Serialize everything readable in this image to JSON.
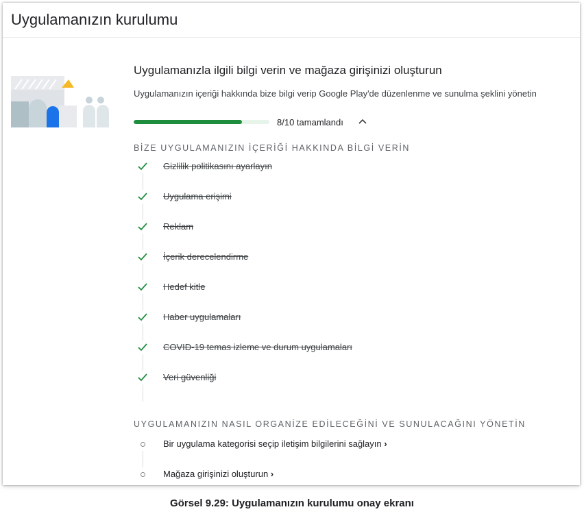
{
  "page": {
    "title": "Uygulamanızın kurulumu"
  },
  "section": {
    "heading": "Uygulamanızla ilgili bilgi verin ve mağaza girişinizi oluşturun",
    "description": "Uygulamanızın içeriği hakkında bize bilgi verip Google Play'de düzenlenme ve sunulma şeklini yönetin",
    "progress": {
      "completed": 8,
      "total": 10,
      "label": "8/10 tamamlandı"
    }
  },
  "groups": [
    {
      "title": "BİZE UYGULAMANIZIN İÇERİĞİ HAKKINDA BİLGİ VERİN",
      "tasks": [
        {
          "label": "Gizlilik politikasını ayarlayın",
          "status": "done"
        },
        {
          "label": "Uygulama erişimi",
          "status": "done"
        },
        {
          "label": "Reklam",
          "status": "done"
        },
        {
          "label": "İçerik derecelendirme",
          "status": "done"
        },
        {
          "label": "Hedef kitle",
          "status": "done"
        },
        {
          "label": "Haber uygulamaları",
          "status": "done"
        },
        {
          "label": "COVID-19 temas izleme ve durum uygulamaları",
          "status": "done"
        },
        {
          "label": "Veri güvenliği",
          "status": "done"
        }
      ]
    },
    {
      "title": "UYGULAMANIZIN NASIL ORGANİZE EDİLECEĞİNİ VE SUNULACAĞINI YÖNETİN",
      "tasks": [
        {
          "label": "Bir uygulama kategorisi seçip iletişim bilgilerini sağlayın",
          "status": "pending"
        },
        {
          "label": "Mağaza girişinizi oluşturun",
          "status": "pending"
        }
      ]
    }
  ],
  "caption": "Görsel 9.29: Uygulamanızın kurulumu onay ekranı",
  "colors": {
    "accent_green": "#1e8e3e",
    "progress_track": "#e6f4ea",
    "text": "#202124",
    "muted": "#5f6368"
  },
  "icons": {
    "done": "check-icon",
    "pending": "circle-icon",
    "toggle": "chevron-up-icon"
  }
}
